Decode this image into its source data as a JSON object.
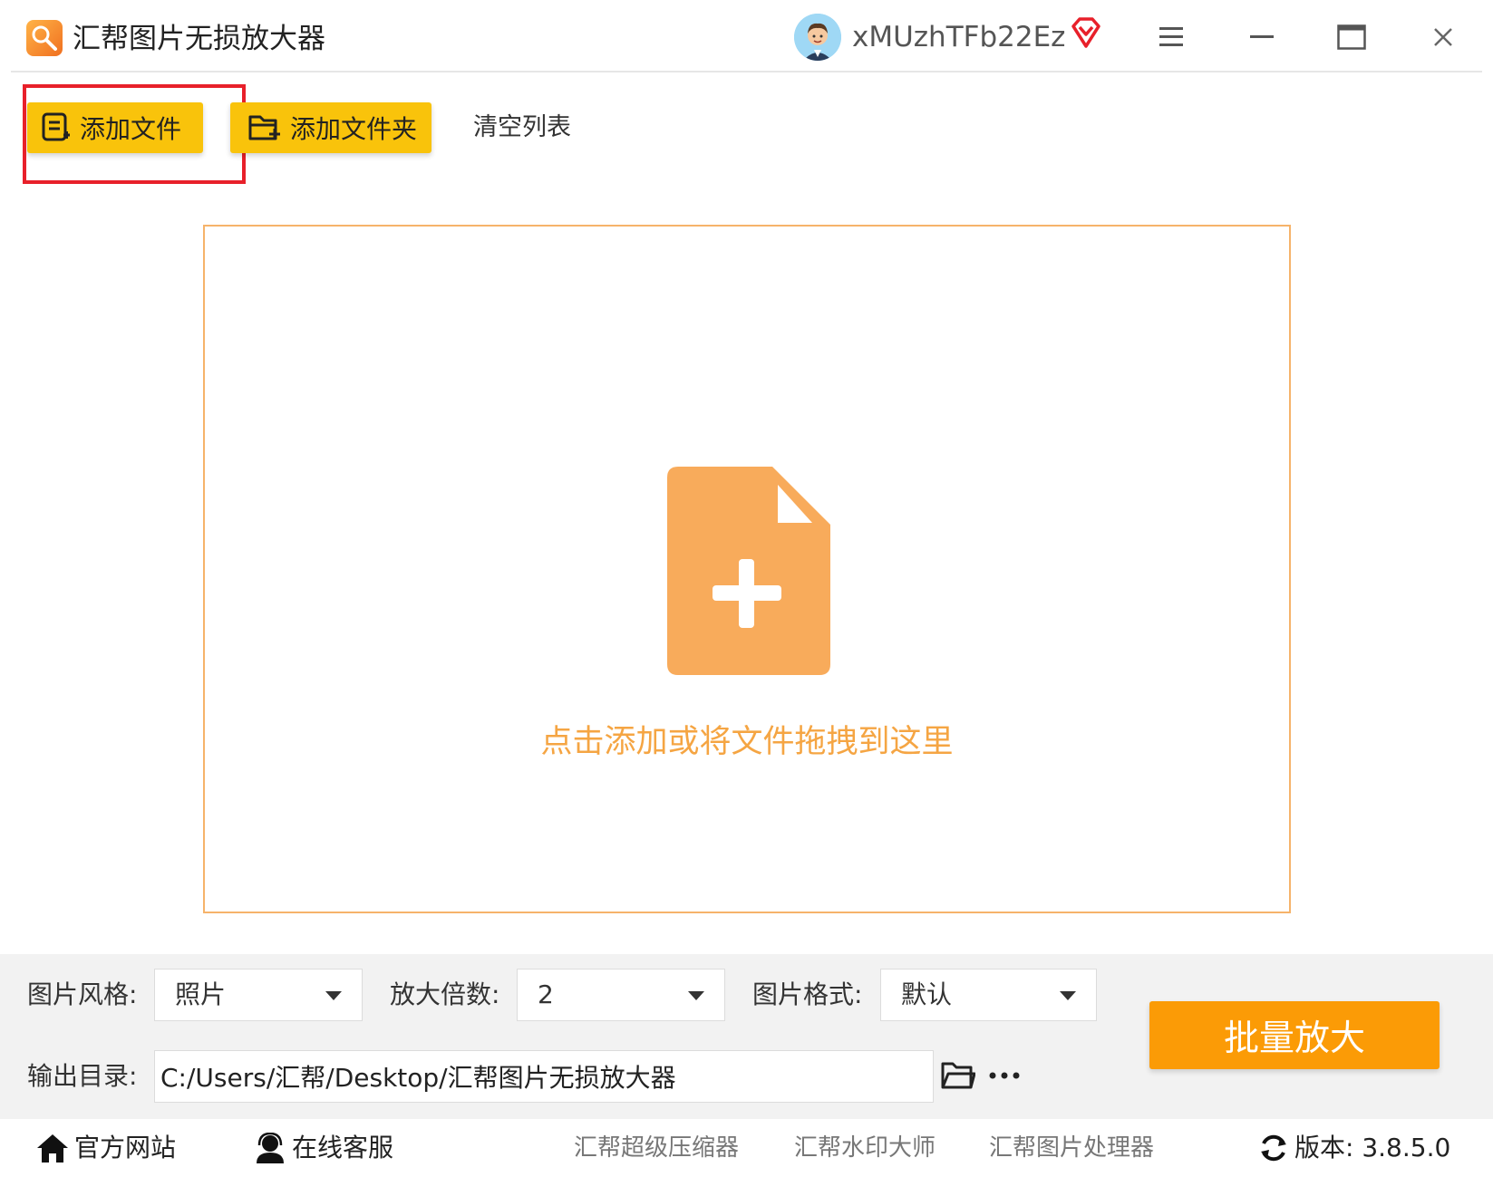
{
  "titlebar": {
    "app_title": "汇帮图片无损放大器",
    "username": "xMUzhTFb22Ez"
  },
  "toolbar": {
    "add_file": "添加文件",
    "add_folder": "添加文件夹",
    "clear_list": "清空列表"
  },
  "dropzone": {
    "hint": "点击添加或将文件拖拽到这里"
  },
  "settings": {
    "style_label": "图片风格:",
    "style_value": "照片",
    "scale_label": "放大倍数:",
    "scale_value": "2",
    "format_label": "图片格式:",
    "format_value": "默认",
    "output_label": "输出目录:",
    "output_path": "C:/Users/汇帮/Desktop/汇帮图片无损放大器",
    "batch_button": "批量放大"
  },
  "footer": {
    "official_site": "官方网站",
    "online_service": "在线客服",
    "product_compressor": "汇帮超级压缩器",
    "product_watermark": "汇帮水印大师",
    "product_image_processor": "汇帮图片处理器",
    "version": "版本: 3.8.5.0"
  },
  "colors": {
    "accent_yellow": "#f9c30b",
    "accent_orange": "#fb9b06",
    "drop_border": "#f6b36a",
    "drop_text": "#f5a543",
    "highlight_red": "#e8202a"
  },
  "icons": {
    "app_logo": "magnifier-logo-icon",
    "vip": "vip-diamond-icon",
    "menu": "menu-icon",
    "minimize": "minimize-icon",
    "maximize": "maximize-icon",
    "close": "close-icon",
    "add_file": "file-list-icon",
    "add_folder": "folder-add-icon",
    "drop": "file-add-icon",
    "browse": "folder-open-icon",
    "more": "more-dots-icon",
    "home": "home-icon",
    "support": "support-agent-icon",
    "refresh": "refresh-icon"
  }
}
